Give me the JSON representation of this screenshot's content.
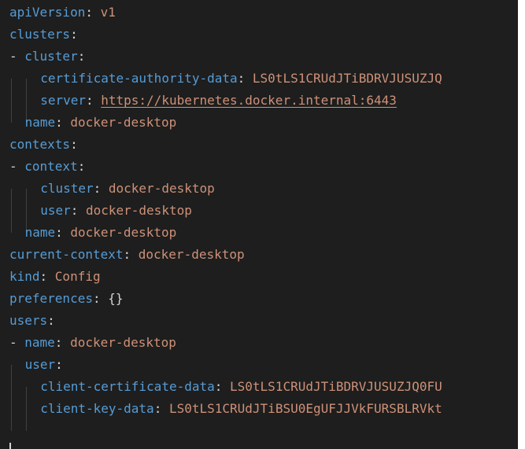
{
  "editor": {
    "lines": [
      {
        "indent": 0,
        "dash": "",
        "key": "apiVersion",
        "value": "v1",
        "kind": "value"
      },
      {
        "indent": 0,
        "dash": "",
        "key": "clusters",
        "value": "",
        "kind": "value"
      },
      {
        "indent": 0,
        "dash": "- ",
        "key": "cluster",
        "value": "",
        "kind": "value"
      },
      {
        "indent": 4,
        "dash": "",
        "key": "certificate-authority-data",
        "value": "LS0tLS1CRUdJTiBDRVJUSUZJQ",
        "kind": "value"
      },
      {
        "indent": 4,
        "dash": "",
        "key": "server",
        "value": "https://kubernetes.docker.internal:6443",
        "kind": "link"
      },
      {
        "indent": 2,
        "dash": "",
        "key": "name",
        "value": "docker-desktop",
        "kind": "value"
      },
      {
        "indent": 0,
        "dash": "",
        "key": "contexts",
        "value": "",
        "kind": "value"
      },
      {
        "indent": 0,
        "dash": "- ",
        "key": "context",
        "value": "",
        "kind": "value"
      },
      {
        "indent": 4,
        "dash": "",
        "key": "cluster",
        "value": "docker-desktop",
        "kind": "value"
      },
      {
        "indent": 4,
        "dash": "",
        "key": "user",
        "value": "docker-desktop",
        "kind": "value"
      },
      {
        "indent": 2,
        "dash": "",
        "key": "name",
        "value": "docker-desktop",
        "kind": "value"
      },
      {
        "indent": 0,
        "dash": "",
        "key": "current-context",
        "value": "docker-desktop",
        "kind": "value"
      },
      {
        "indent": 0,
        "dash": "",
        "key": "kind",
        "value": "Config",
        "kind": "value"
      },
      {
        "indent": 0,
        "dash": "",
        "key": "preferences",
        "value": "{}",
        "kind": "plain"
      },
      {
        "indent": 0,
        "dash": "",
        "key": "users",
        "value": "",
        "kind": "value"
      },
      {
        "indent": 0,
        "dash": "- ",
        "key": "name",
        "value": "docker-desktop",
        "kind": "value"
      },
      {
        "indent": 2,
        "dash": "",
        "key": "user",
        "value": "",
        "kind": "value"
      },
      {
        "indent": 4,
        "dash": "",
        "key": "client-certificate-data",
        "value": "LS0tLS1CRUdJTiBDRVJUSUZJQ0FU",
        "kind": "value"
      },
      {
        "indent": 4,
        "dash": "",
        "key": "client-key-data",
        "value": "LS0tLS1CRUdJTiBSU0EgUFJJVkFURSBLRVkt",
        "kind": "value"
      }
    ]
  },
  "colors": {
    "background": "#1e1e1e",
    "key": "#569cd6",
    "string": "#ce9178",
    "text": "#d4d4d4"
  }
}
